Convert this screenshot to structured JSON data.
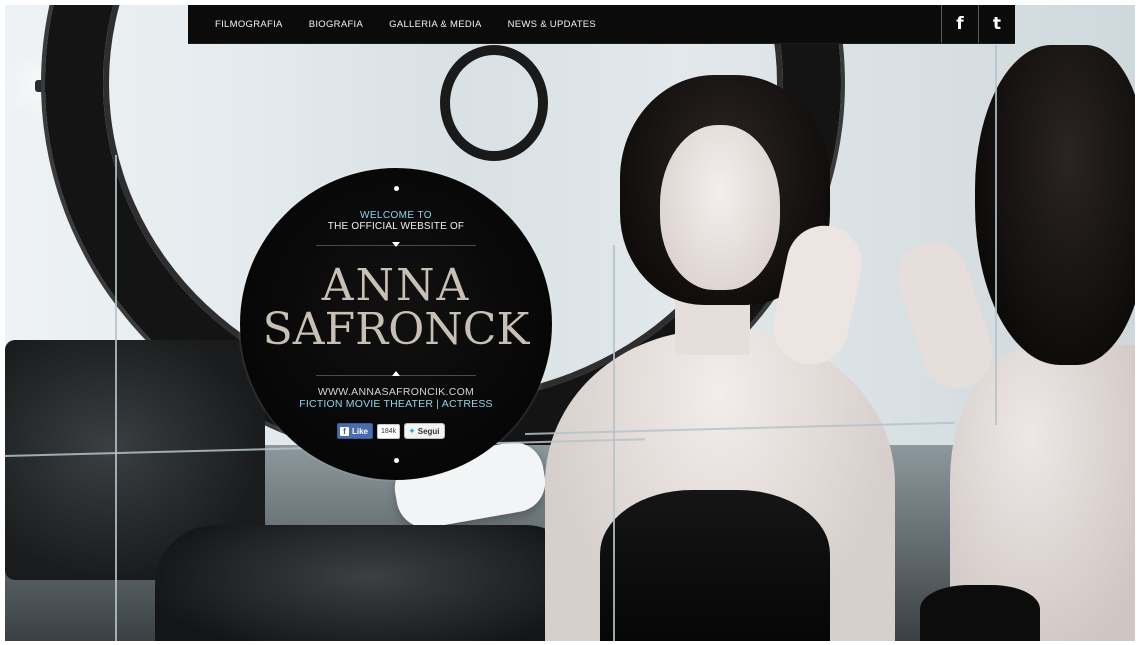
{
  "nav": {
    "items": [
      {
        "label": "FILMOGRAFIA"
      },
      {
        "label": "BIOGRAFIA"
      },
      {
        "label": "GALLERIA & MEDIA"
      },
      {
        "label": "NEWS & UPDATES"
      }
    ],
    "social": {
      "facebook_glyph": "f",
      "twitter_glyph": "t"
    }
  },
  "hero": {
    "welcome_line1": "WELCOME TO",
    "welcome_line2": "THE OFFICIAL WEBSITE OF",
    "name_first": "ANNA",
    "name_last": "SAFRONCK",
    "url": "WWW.ANNASAFRONCIK.COM",
    "role": "FICTION MOVIE THEATER | ACTRESS"
  },
  "share": {
    "like_label": "Like",
    "like_count": "184k",
    "follow_label": "Segui"
  },
  "colors": {
    "accent": "#8fd3e6",
    "name_gold": "#c8c0b4",
    "nav_bg": "#0b0b0b"
  },
  "icons": {
    "facebook": "facebook-icon",
    "twitter": "twitter-icon"
  }
}
